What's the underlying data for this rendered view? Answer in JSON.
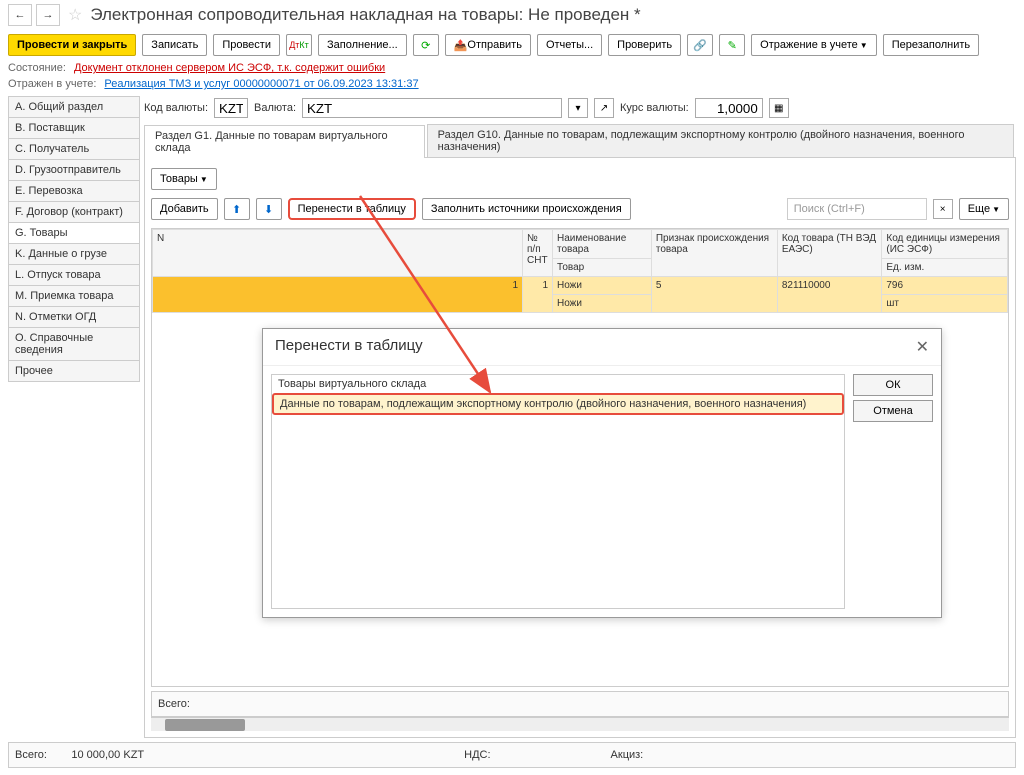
{
  "header": {
    "title": "Электронная сопроводительная накладная на товары: Не проведен *"
  },
  "toolbar": {
    "post_close": "Провести и закрыть",
    "write": "Записать",
    "post": "Провести",
    "fill": "Заполнение...",
    "send": "Отправить",
    "reports": "Отчеты...",
    "check": "Проверить",
    "reflect": "Отражение в учете",
    "refill": "Перезаполнить"
  },
  "status": {
    "label1": "Состояние:",
    "value1": "Документ отклонен сервером ИС ЭСФ, т.к. содержит ошибки",
    "label2": "Отражен в учете:",
    "value2": "Реализация ТМЗ и услуг 00000000071 от 06.09.2023 13:31:37"
  },
  "sidebar": {
    "items": [
      "A. Общий раздел",
      "B. Поставщик",
      "C. Получатель",
      "D. Грузоотправитель",
      "E. Перевозка",
      "F. Договор (контракт)",
      "G. Товары",
      "K. Данные о грузе",
      "L. Отпуск товара",
      "M. Приемка товара",
      "N. Отметки ОГД",
      "O. Справочные сведения",
      "Прочее"
    ],
    "active_index": 6
  },
  "currency": {
    "code_label": "Код валюты:",
    "code_value": "KZT",
    "name_label": "Валюта:",
    "name_value": "KZT",
    "rate_label": "Курс валюты:",
    "rate_value": "1,0000"
  },
  "tabs": {
    "t1": "Раздел G1. Данные по товарам виртуального склада",
    "t2": "Раздел G10. Данные по товарам, подлежащим экспортному контролю (двойного назначения, военного назначения)"
  },
  "subtoolbar": {
    "goods": "Товары",
    "add": "Добавить",
    "transfer": "Перенести в таблицу",
    "fill_sources": "Заполнить источники происхождения",
    "search_placeholder": "Поиск (Ctrl+F)",
    "more": "Еще"
  },
  "table": {
    "headers": {
      "n": "N",
      "npp": "№ п/п СНТ",
      "name1": "Наименование товара",
      "name2": "Товар",
      "origin": "Признак происхождения товара",
      "code1": "Код товара (ТН ВЭД ЕАЭС)",
      "unit1": "Код единицы измерения (ИС ЭСФ)",
      "unit2": "Ед. изм."
    },
    "rows": [
      {
        "n": "1",
        "npp": "1",
        "name": "Ножи",
        "tovar": "Ножи",
        "origin": "5",
        "code": "821110000",
        "unit_code": "796",
        "unit": "шт"
      }
    ],
    "total_label": "Всего:"
  },
  "modal": {
    "title": "Перенести в таблицу",
    "items": [
      "Товары виртуального склада",
      "Данные по товарам, подлежащим экспортному контролю (двойного назначения, военного назначения)"
    ],
    "ok": "ОК",
    "cancel": "Отмена"
  },
  "footer": {
    "total": "Всего:",
    "total_val": "10 000,00  KZT",
    "nds": "НДС:",
    "akciz": "Акциз:"
  }
}
